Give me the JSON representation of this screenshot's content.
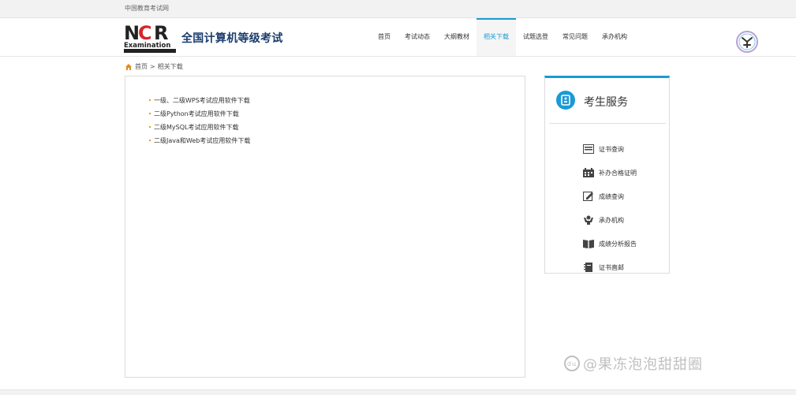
{
  "topbar": {
    "site_name": "中国教育考试网"
  },
  "header": {
    "logo_text": "NCR",
    "logo_sub": "Examination",
    "title": "全国计算机等级考试"
  },
  "nav": {
    "items": [
      {
        "label": "首页"
      },
      {
        "label": "考试动态"
      },
      {
        "label": "大纲教材"
      },
      {
        "label": "相关下载"
      },
      {
        "label": "试题选登"
      },
      {
        "label": "常见问题"
      },
      {
        "label": "承办机构"
      }
    ],
    "active_index": 3
  },
  "breadcrumb": {
    "home": "首页",
    "separator": ">",
    "current": "相关下载"
  },
  "downloads": {
    "items": [
      {
        "label": "一级、二级WPS考试应用软件下载"
      },
      {
        "label": "二级Python考试应用软件下载"
      },
      {
        "label": "二级MySQL考试应用软件下载"
      },
      {
        "label": "二级Java和Web考试应用软件下载"
      }
    ]
  },
  "services": {
    "title": "考生服务",
    "items": [
      {
        "label": "证书查询",
        "icon": "certificate-icon"
      },
      {
        "label": "补办合格证明",
        "icon": "calendar-icon"
      },
      {
        "label": "成绩查询",
        "icon": "edit-icon"
      },
      {
        "label": "承办机构",
        "icon": "organization-icon"
      },
      {
        "label": "成绩分析报告",
        "icon": "book-icon"
      },
      {
        "label": "证书直邮",
        "icon": "notebook-icon"
      }
    ]
  },
  "watermark": {
    "text": "@果冻泡泡甜甜圈"
  },
  "colors": {
    "accent": "#1b9ad6",
    "title": "#1b3d6d",
    "logo_red": "#d8242a",
    "bullet": "#e6a100"
  }
}
